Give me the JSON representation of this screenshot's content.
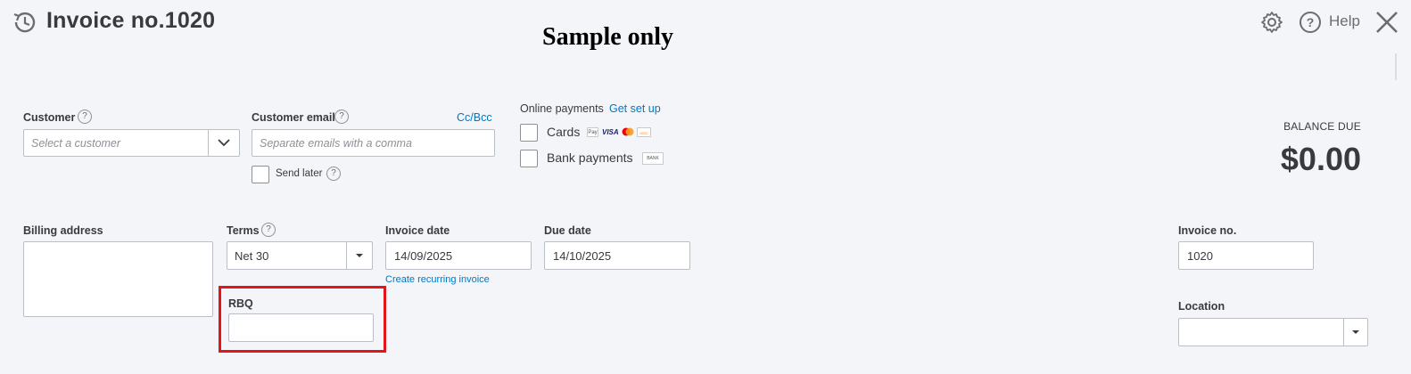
{
  "header": {
    "title": "Invoice no.1020",
    "watermark": "Sample only",
    "help_label": "Help"
  },
  "customer": {
    "label": "Customer",
    "placeholder": "Select a customer"
  },
  "customer_email": {
    "label": "Customer email",
    "placeholder": "Separate emails with a comma",
    "cc_bcc_label": "Cc/Bcc",
    "send_later_label": "Send later"
  },
  "online_payments": {
    "label": "Online payments",
    "setup_link": "Get set up",
    "cards_label": "Cards",
    "bank_label": "Bank payments",
    "bank_badge": "BANK",
    "card_badges": [
      "Pay",
      "VISA",
      "",
      "DISC"
    ]
  },
  "balance": {
    "label": "BALANCE DUE",
    "amount": "$0.00"
  },
  "billing": {
    "label": "Billing address",
    "value": ""
  },
  "terms": {
    "label": "Terms",
    "value": "Net 30"
  },
  "invoice_date": {
    "label": "Invoice date",
    "value": "14/09/2025",
    "recurring_link": "Create recurring invoice"
  },
  "due_date": {
    "label": "Due date",
    "value": "14/10/2025"
  },
  "rbq": {
    "label": "RBQ",
    "value": ""
  },
  "invoice_no": {
    "label": "Invoice no.",
    "value": "1020"
  },
  "location": {
    "label": "Location",
    "value": ""
  },
  "colors": {
    "link": "#0077c5",
    "highlight": "#e0161b",
    "text": "#393a3d"
  }
}
